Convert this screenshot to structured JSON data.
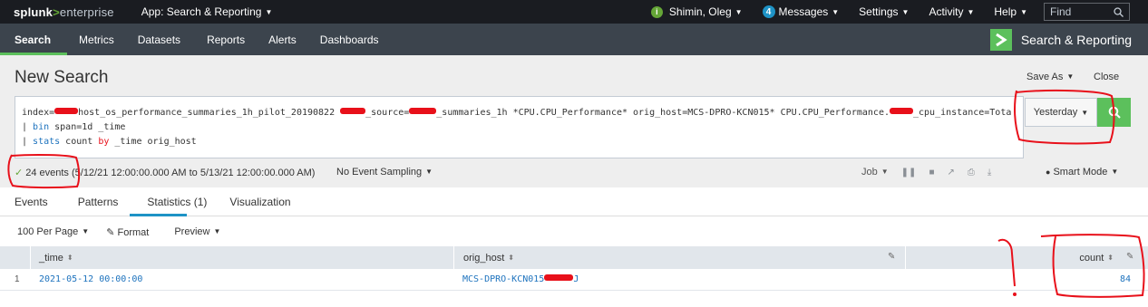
{
  "topbar": {
    "logo_main": "splunk",
    "logo_gt": ">",
    "logo_sub": "enterprise",
    "app_menu": "App: Search & Reporting",
    "user_name": "Shimin, Oleg",
    "messages_count": "4",
    "messages_label": "Messages",
    "settings": "Settings",
    "activity": "Activity",
    "help": "Help",
    "find_placeholder": "Find"
  },
  "appnav": {
    "items": [
      "Search",
      "Metrics",
      "Datasets",
      "Reports",
      "Alerts",
      "Dashboards"
    ],
    "brand": "Search & Reporting"
  },
  "header": {
    "title": "New Search",
    "save_as": "Save As",
    "close": "Close"
  },
  "search": {
    "line1_a": "index=",
    "line1_b": "host_os_performance_summaries_1h_pilot_20190822 ",
    "line1_c": "_source=",
    "line1_d": "_summaries_1h *CPU.CPU_Performance* orig_host=MCS-DPRO-KCN015* CPU.CPU_Performance.",
    "line1_e": "_cpu_instance=Tota",
    "line2_pipe": "| ",
    "line2_cmd": "bin",
    "line2_rest": " span=1d _time",
    "line3_pipe": "| ",
    "line3_cmd": "stats",
    "line3_mid": " count ",
    "line3_by": "by",
    "line3_rest": " _time orig_host",
    "time_range": "Yesterday"
  },
  "meta": {
    "events": "24 events (5/12/21 12:00:00.000 AM to 5/13/21 12:00:00.000 AM)",
    "sampling": "No Event Sampling",
    "job": "Job",
    "mode": "Smart Mode"
  },
  "tabs": [
    "Events",
    "Patterns",
    "Statistics (1)",
    "Visualization"
  ],
  "table_controls": {
    "per_page": "100 Per Page",
    "format": "Format",
    "preview": "Preview"
  },
  "table": {
    "columns": [
      "_time",
      "orig_host",
      "count"
    ],
    "rows": [
      {
        "index": "1",
        "time": "2021-05-12 00:00:00",
        "orig_host": "MCS-DPRO-KCN015",
        "orig_host_tail": "J",
        "count": "84"
      }
    ]
  },
  "colors": {
    "topbar": "#1a1c21",
    "appbar": "#3c444d",
    "accent_green": "#5cc05c",
    "link_blue": "#1e73be",
    "annotation_red": "#e8101a"
  }
}
